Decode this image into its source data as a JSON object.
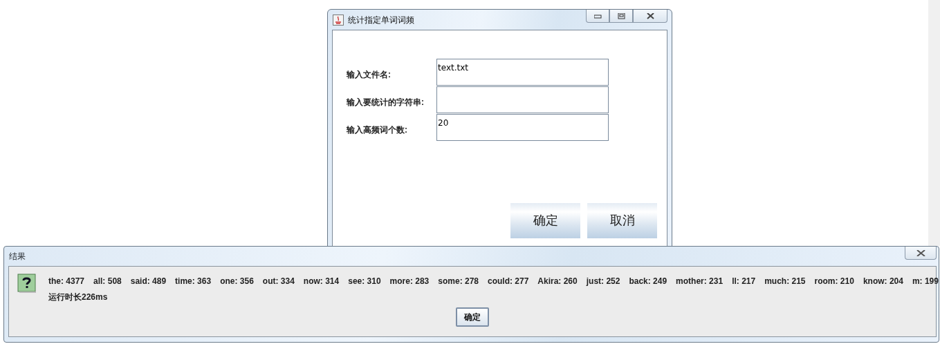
{
  "main_window": {
    "title": "统计指定单词词频",
    "fields": [
      {
        "label": "输入文件名:",
        "value": "text.txt"
      },
      {
        "label": "输入要统计的字符串:"
      },
      {
        "label": "输入高频词个数:",
        "value": "20"
      }
    ],
    "buttons": [
      "确定",
      "取消"
    ]
  },
  "dialog": {
    "title": "结果",
    "counts": [
      "the: 4377",
      "all: 508",
      "said: 489",
      "time: 363",
      "one: 356",
      "out: 334",
      "now: 314",
      "see: 310",
      "more: 283",
      "some: 278",
      "could: 277",
      "Akira: 260",
      "just: 252",
      "back: 249",
      "mother: 231",
      "ll: 217",
      "much: 215",
      "room: 210",
      "know: 204",
      "m: 199"
    ],
    "runtime": "运行时长226ms",
    "button": "确定"
  }
}
